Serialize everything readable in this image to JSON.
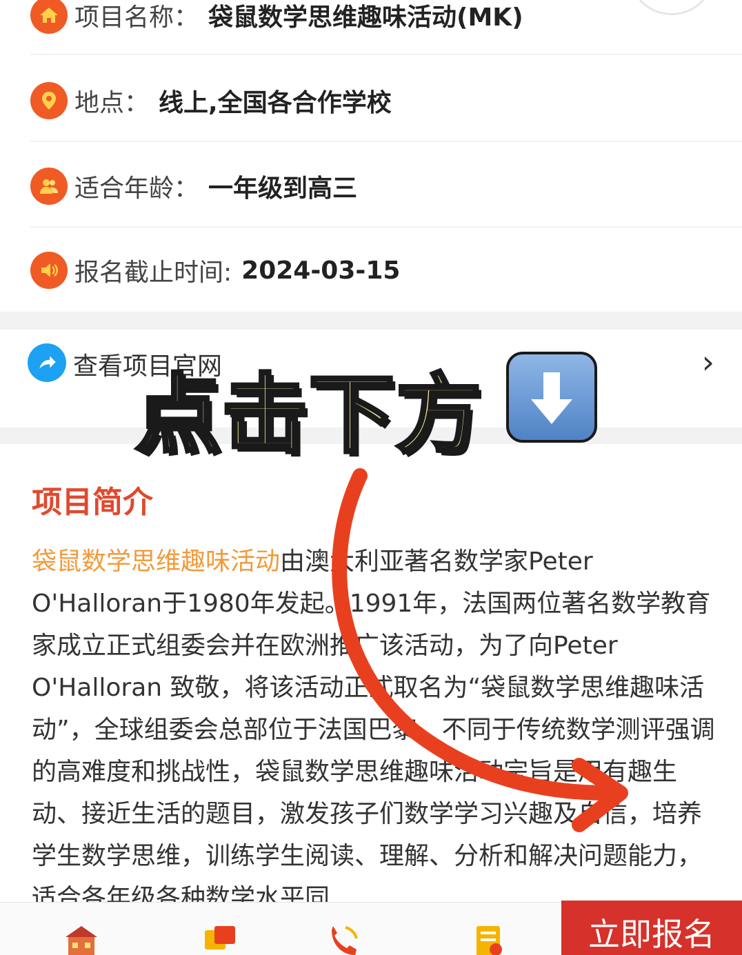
{
  "info": {
    "project_name_label": "项目名称：",
    "project_name_value": "袋鼠数学思维趣味活动(MK)",
    "location_label": "地点：",
    "location_value": "线上,全国各合作学校",
    "age_label": "适合年龄：",
    "age_value": "一年级到高三",
    "deadline_label": "报名截止时间:",
    "deadline_value": "2024-03-15"
  },
  "link_row": {
    "label": "查看项目官网",
    "chevron": "›"
  },
  "overlay": {
    "text": "点击下方",
    "arrow_glyph": "⬇"
  },
  "intro": {
    "title": "项目简介",
    "highlight": "袋鼠数学思维趣味活动",
    "body": "由澳大利亚著名数学家Peter O'Halloran于1980年发起。1991年，法国两位著名数学教育家成立正式组委会并在欧洲推广该活动，为了向Peter O'Halloran 致敬，将该活动正式取名为“袋鼠数学思维趣味活动”，全球组委会总部位于法国巴黎。不同于传统数学测评强调的高难度和挑战性，袋鼠数学思维趣味活动宗旨是用有趣生动、接近生活的题目，激发孩子们数学学习兴趣及自信，培养学生数学思维，训练学生阅读、理解、分析和解决问题能力，适合各年级各种数学水平同"
  },
  "bottom_bar": {
    "tabs": [
      "home-icon",
      "chat-icon",
      "phone-icon",
      "form-icon"
    ],
    "signup_label": "立即报名"
  },
  "colors": {
    "accent": "#f05a25",
    "title_red": "#e0492d",
    "highlight_orange": "#f29a3a",
    "signup_red": "#d6312a",
    "link_blue": "#1da1f2",
    "overlay_yellow": "#f8eea0"
  }
}
